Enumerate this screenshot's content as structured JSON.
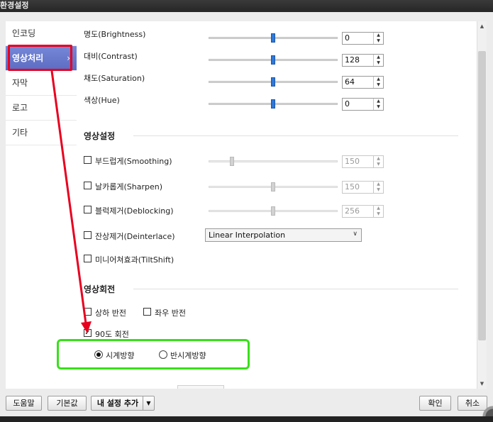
{
  "window": {
    "title": "환경설정"
  },
  "sidebar": {
    "items": [
      {
        "label": "인코딩"
      },
      {
        "label": "영상처리",
        "chevron": "›"
      },
      {
        "label": "자막"
      },
      {
        "label": "로고"
      },
      {
        "label": "기타"
      }
    ]
  },
  "adjust": {
    "brightness": {
      "label": "명도(Brightness)",
      "value": "0"
    },
    "contrast": {
      "label": "대비(Contrast)",
      "value": "128"
    },
    "saturation": {
      "label": "채도(Saturation)",
      "value": "64"
    },
    "hue": {
      "label": "색상(Hue)",
      "value": "0"
    }
  },
  "video_settings": {
    "title": "영상설정",
    "smoothing": {
      "label": "부드럽게(Smoothing)",
      "value": "150",
      "checked": false
    },
    "sharpen": {
      "label": "날카롭게(Sharpen)",
      "value": "150",
      "checked": false
    },
    "deblocking": {
      "label": "블럭제거(Deblocking)",
      "value": "256",
      "checked": false
    },
    "deinterlace": {
      "label": "잔상제거(Deinterlace)",
      "method": "Linear Interpolation",
      "checked": false
    },
    "tiltshift": {
      "label": "미니어쳐효과(TiltShift)",
      "checked": false
    }
  },
  "rotation": {
    "title": "영상회전",
    "flip_vertical": {
      "label": "상하 반전",
      "checked": false
    },
    "flip_horizontal": {
      "label": "좌우 반전",
      "checked": false
    },
    "rotate90": {
      "label": "90도 회전",
      "checked": true
    },
    "clockwise": {
      "label": "시계방향",
      "selected": true
    },
    "counterclockwise": {
      "label": "반시계방향",
      "selected": false
    }
  },
  "footer": {
    "help": "도움말",
    "defaults": "기본값",
    "add_my_settings": "내 설정 추가",
    "ok": "확인",
    "cancel": "취소"
  },
  "colors": {
    "accent_selection": "#5c6cc2",
    "slider_knob": "#2f78d8",
    "annotation_red": "#e8001f",
    "annotation_green": "#39e01b"
  }
}
